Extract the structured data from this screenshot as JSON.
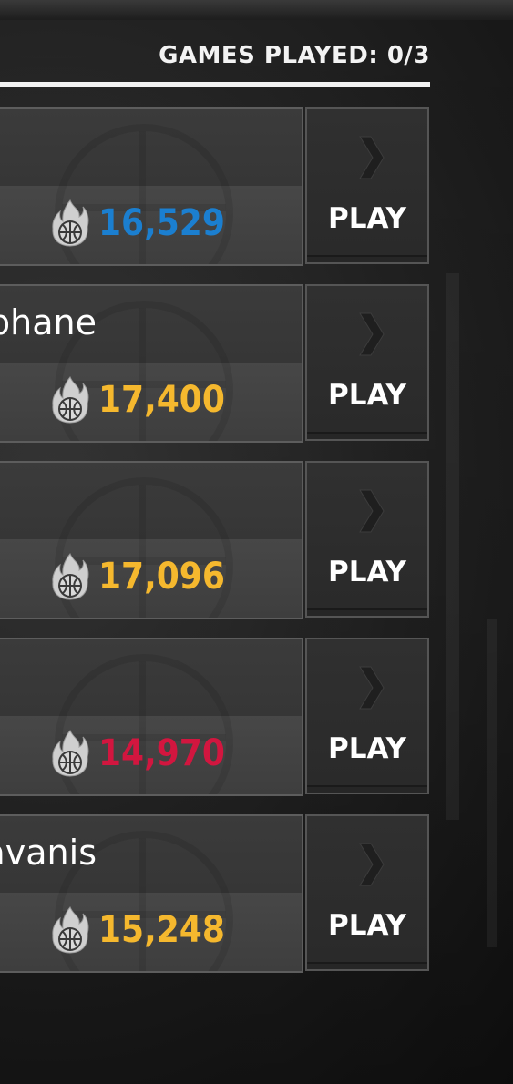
{
  "header": {
    "games_played": "GAMES PLAYED: 0/3"
  },
  "colors": {
    "blue": "#1b7fd0",
    "yellow": "#f5b82e",
    "red": "#d2163f"
  },
  "entries": [
    {
      "name": "",
      "score": "16,529",
      "score_color": "#1b7fd0",
      "play_label": "PLAY"
    },
    {
      "name": "phane",
      "score": "17,400",
      "score_color": "#f5b82e",
      "play_label": "PLAY"
    },
    {
      "name": "",
      "score": "17,096",
      "score_color": "#f5b82e",
      "play_label": "PLAY"
    },
    {
      "name": "",
      "score": "14,970",
      "score_color": "#d2163f",
      "play_label": "PLAY"
    },
    {
      "name": "os Valavanis",
      "score": "15,248",
      "score_color": "#f5b82e",
      "play_label": "PLAY"
    }
  ],
  "icons": {
    "score": "basketball-fire-icon",
    "play": "chevron-right-icon"
  }
}
